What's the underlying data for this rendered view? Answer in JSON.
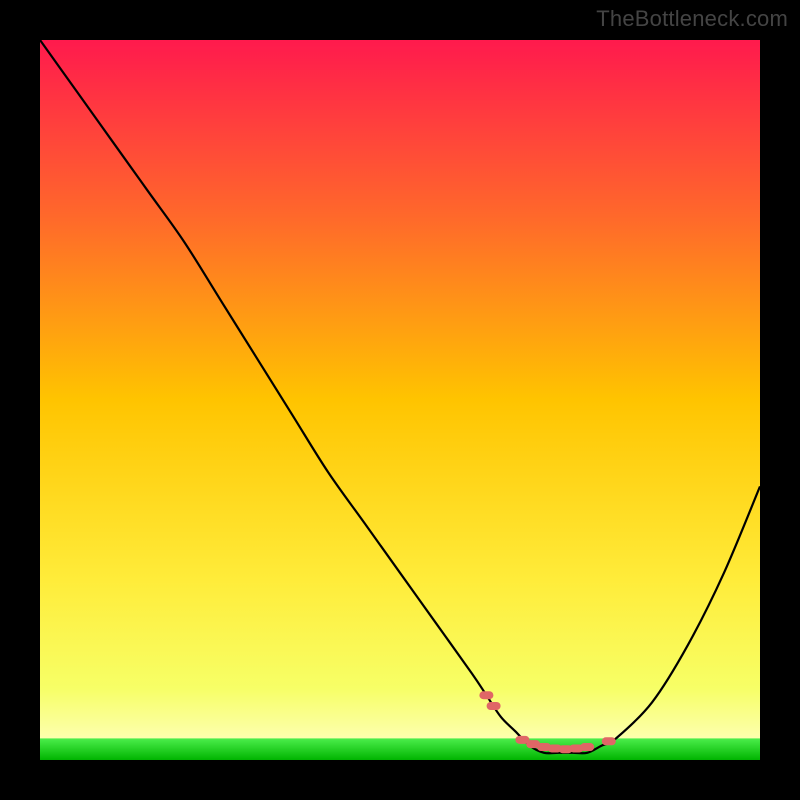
{
  "watermark": "TheBottleneck.com",
  "chart_data": {
    "type": "line",
    "title": "",
    "xlabel": "",
    "ylabel": "",
    "xlim": [
      0,
      100
    ],
    "ylim": [
      0,
      100
    ],
    "curve": {
      "name": "bottleneck-curve",
      "color": "#000000",
      "x": [
        0,
        5,
        10,
        15,
        20,
        25,
        30,
        35,
        40,
        45,
        50,
        55,
        60,
        62,
        64,
        66,
        68,
        70,
        72,
        74,
        76,
        78,
        80,
        85,
        90,
        95,
        100
      ],
      "y": [
        100,
        93,
        86,
        79,
        72,
        64,
        56,
        48,
        40,
        33,
        26,
        19,
        12,
        9,
        6,
        4,
        2,
        1,
        1,
        1,
        1,
        2,
        3,
        8,
        16,
        26,
        38
      ]
    },
    "optimal_band": {
      "name": "optimal-region",
      "color_top": "#4bee4b",
      "color_bottom": "#00b400",
      "x_range": [
        0,
        100
      ],
      "y_range": [
        0,
        3
      ]
    },
    "markers": {
      "name": "sample-points",
      "color": "#e06666",
      "x": [
        62.0,
        63.0,
        67.0,
        68.5,
        70.0,
        71.5,
        73.0,
        74.5,
        76.0,
        79.0
      ],
      "y": [
        9.0,
        7.5,
        2.8,
        2.2,
        1.8,
        1.6,
        1.5,
        1.6,
        1.8,
        2.6
      ]
    },
    "gradient_stops": [
      {
        "offset": 0.0,
        "color": "#ff1a4d"
      },
      {
        "offset": 0.25,
        "color": "#ff6a2a"
      },
      {
        "offset": 0.5,
        "color": "#ffc400"
      },
      {
        "offset": 0.75,
        "color": "#ffec3a"
      },
      {
        "offset": 0.9,
        "color": "#f7ff66"
      },
      {
        "offset": 1.0,
        "color": "#ffffcc"
      }
    ]
  }
}
